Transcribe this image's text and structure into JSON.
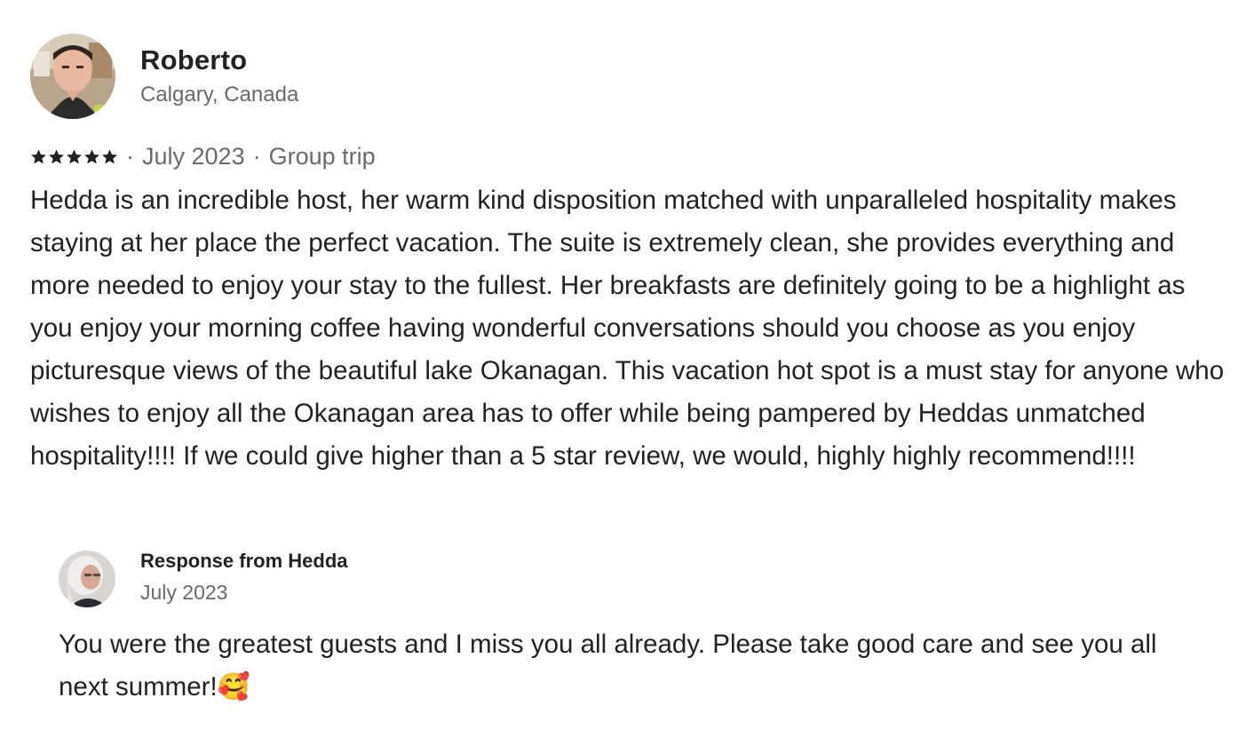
{
  "review": {
    "reviewer_name": "Roberto",
    "reviewer_location": "Calgary, Canada",
    "rating": 5,
    "date": "July 2023",
    "trip_type": "Group trip",
    "separator": "·",
    "text": "Hedda is an incredible host, her warm kind disposition matched with unparalleled hospitality makes staying at her place the perfect vacation. The suite is extremely clean, she provides everything and more needed to enjoy your stay to the fullest. Her breakfasts are definitely going to be a highlight as you enjoy your morning coffee having wonderful conversations should you choose as you enjoy picturesque views of the beautiful lake Okanagan. This vacation hot spot is a must stay for anyone who wishes to enjoy all the Okanagan area has to offer while being pampered by Heddas unmatched hospitality!!!! If we could give higher than a 5 star review, we would, highly highly recommend!!!!"
  },
  "response": {
    "title": "Response from Hedda",
    "date": "July 2023",
    "text": "You were the greatest guests and I miss you all already. Please take good care and see you all next summer!🥰"
  },
  "icons": {
    "star": "star-icon",
    "reviewer_avatar": "reviewer-avatar",
    "host_avatar": "host-avatar"
  },
  "colors": {
    "primary_text": "#222222",
    "secondary_text": "#6a6a6a"
  }
}
